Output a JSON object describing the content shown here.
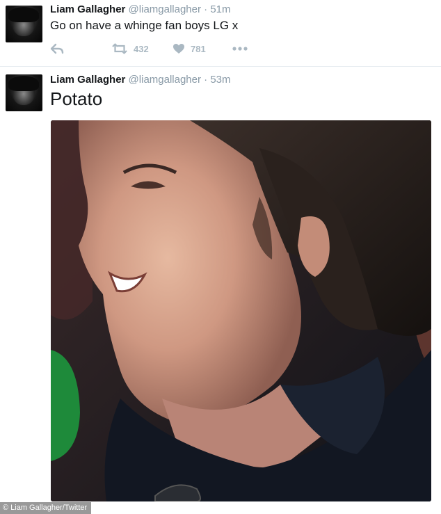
{
  "tweets": [
    {
      "name": "Liam Gallagher",
      "handle": "@liamgallagher",
      "separator": "·",
      "time": "51m",
      "text": "Go on have a whinge fan boys LG x",
      "retweets": "432",
      "likes": "781",
      "icons": {
        "reply": "reply-icon",
        "retweet": "retweet-icon",
        "like": "heart-icon",
        "more": "more-icon"
      }
    },
    {
      "name": "Liam Gallagher",
      "handle": "@liamgallagher",
      "separator": "·",
      "time": "53m",
      "text": "Potato",
      "photo": "close-up photo of a man's face in profile, smiling"
    }
  ],
  "credit": "© Liam Gallagher/Twitter",
  "colors": {
    "muted": "#8899a6",
    "icon": "#aab8c2",
    "divider": "#e6ecf0"
  }
}
